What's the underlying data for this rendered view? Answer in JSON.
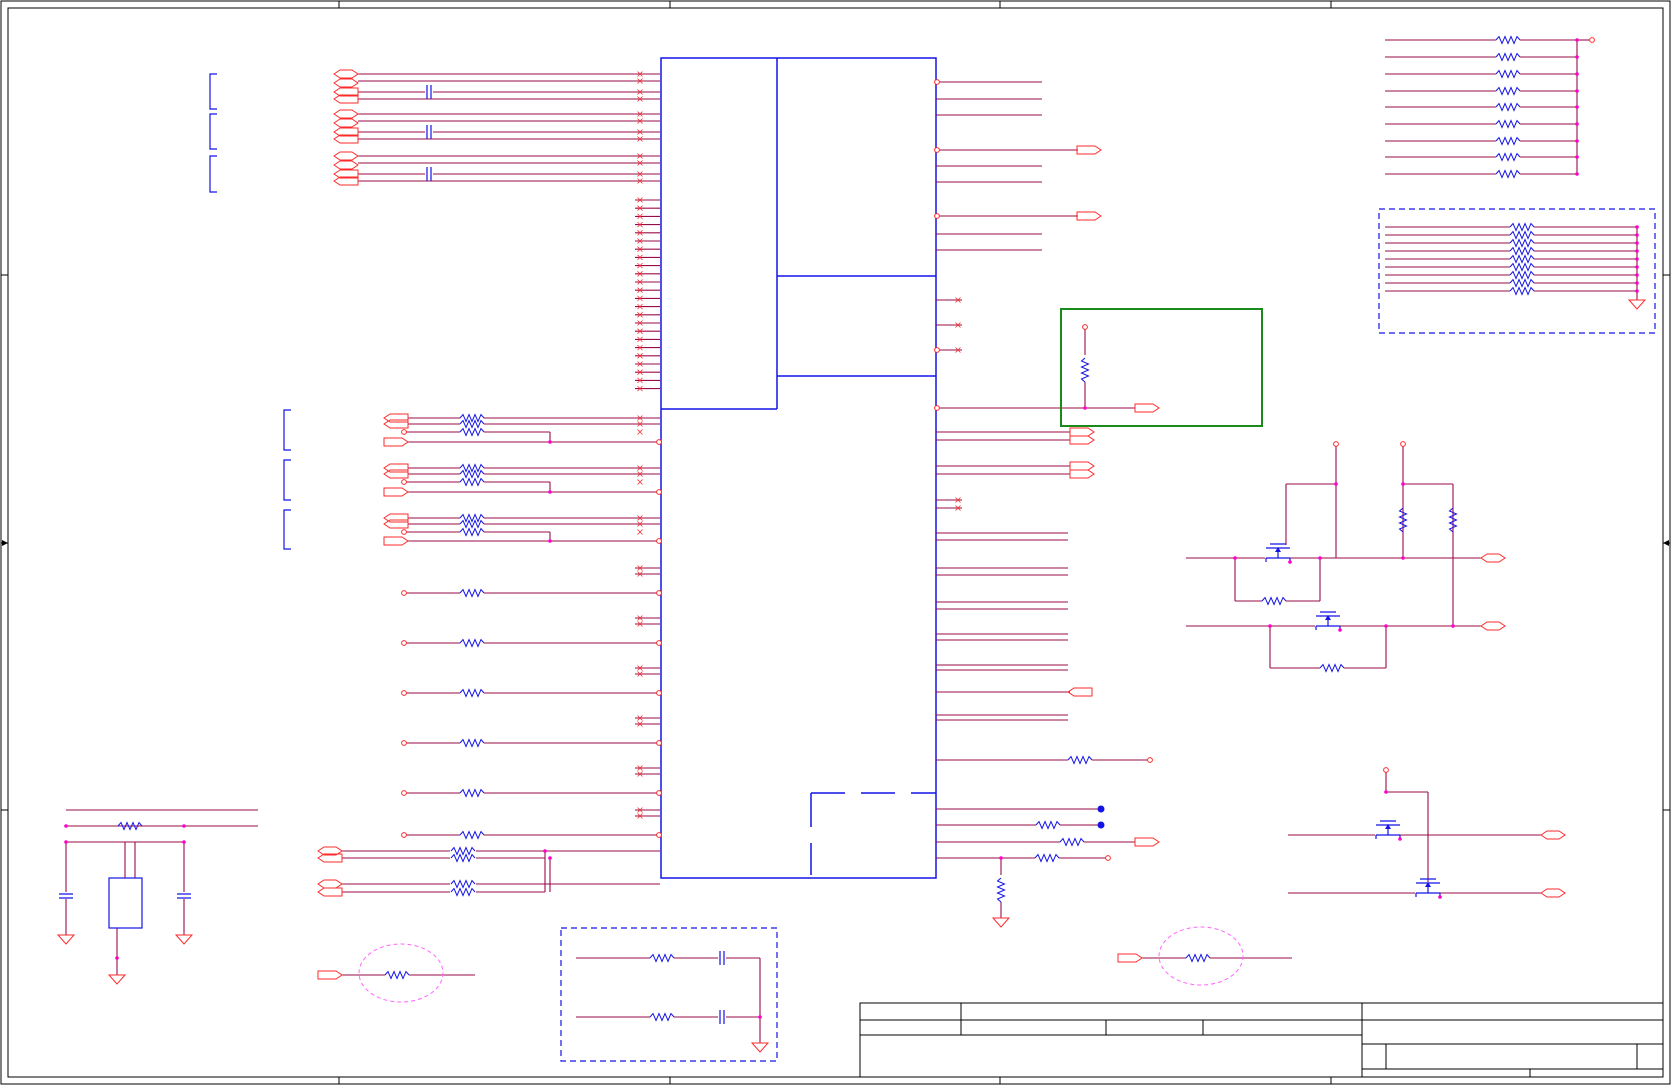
{
  "colors": {
    "wire": "#9b0b4a",
    "pin": "#ff2a2a",
    "component": "#1414e6",
    "junction": "#ff00cc",
    "border": "#000000",
    "green_box": "#1a8a1a",
    "ellipse": "#ff66ff"
  },
  "icons": {
    "resistor": "resistor-icon",
    "capacitor": "capacitor-icon",
    "ground": "ground-icon",
    "mosfet": "mosfet-icon",
    "port": "port-arrow-icon",
    "crystal": "crystal-icon",
    "no_connect": "no-connect-icon"
  }
}
